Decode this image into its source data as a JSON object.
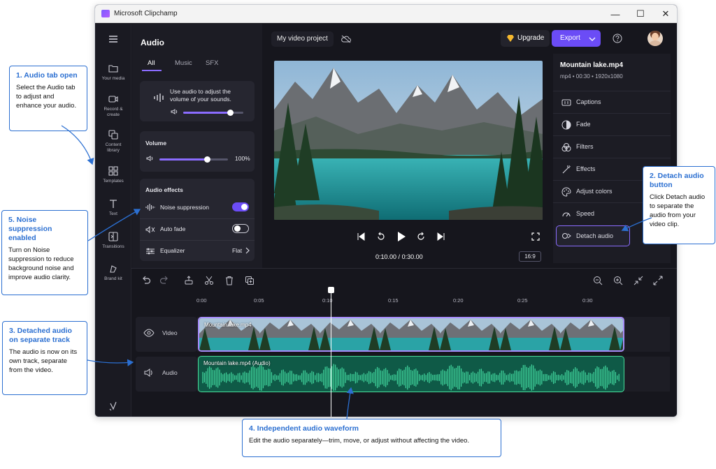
{
  "window": {
    "title": "Microsoft Clipchamp",
    "minimize": "—",
    "maximize": "☐",
    "close": "✕"
  },
  "rail": {
    "items": [
      {
        "label": "Your media",
        "icon": "folder-icon"
      },
      {
        "label": "Record & create",
        "icon": "camera-icon"
      },
      {
        "label": "Content library",
        "icon": "library-icon"
      },
      {
        "label": "Templates",
        "icon": "templates-icon"
      },
      {
        "label": "Text",
        "icon": "text-icon"
      },
      {
        "label": "Transitions",
        "icon": "transitions-icon"
      },
      {
        "label": "Brand kit",
        "icon": "brand-kit-icon"
      }
    ]
  },
  "audio_panel": {
    "title": "Audio",
    "tabs": [
      "All",
      "Music",
      "SFX"
    ],
    "active_tab": "All",
    "info_text": "Use audio to adjust the volume of your sounds.",
    "info_slider_level": 0.78,
    "volume": {
      "label": "Volume",
      "value_text": "100%",
      "level": 0.7
    },
    "effects": {
      "heading": "Audio effects",
      "noise_suppression": {
        "label": "Noise suppression",
        "on": true
      },
      "auto_fade": {
        "label": "Auto fade",
        "on": false
      },
      "equalizer": {
        "label": "Equalizer",
        "value": "Flat"
      }
    }
  },
  "topbar": {
    "project_name": "My video project",
    "upgrade_label": "Upgrade",
    "export_label": "Export"
  },
  "player": {
    "current_time": "0:10.00",
    "separator": "/",
    "total_time": "0:30.00",
    "aspect_ratio": "16:9"
  },
  "properties": {
    "file_name": "Mountain lake.mp4",
    "file_meta": "mp4 • 00:30 • 1920x1080",
    "items": [
      {
        "label": "Captions",
        "icon": "captions-icon"
      },
      {
        "label": "Fade",
        "icon": "fade-icon"
      },
      {
        "label": "Filters",
        "icon": "filters-icon"
      },
      {
        "label": "Effects",
        "icon": "effects-icon"
      },
      {
        "label": "Adjust colors",
        "icon": "adjust-colors-icon"
      },
      {
        "label": "Speed",
        "icon": "speed-icon"
      },
      {
        "label": "Detach audio",
        "icon": "detach-audio-icon"
      }
    ]
  },
  "timeline": {
    "ruler": [
      "0:00",
      "0:05",
      "0:10",
      "0:15",
      "0:20",
      "0:25",
      "0:30"
    ],
    "tracks": {
      "video_label": "Video",
      "audio_label": "Audio"
    },
    "video_clip_name": "Mountain lake.mp4",
    "audio_clip_name": "Mountain lake.mp4 (Audio)"
  },
  "colors": {
    "accent": "#6b4cf6",
    "video_clip_border": "#a78bfa",
    "audio_clip_border": "#4ade9c",
    "callout": "#2b6fd1"
  },
  "callouts": [
    {
      "title": "1. Audio tab open",
      "body": "Select the Audio tab to adjust and enhance your audio."
    },
    {
      "title": "2. Detach audio button",
      "body": "Click Detach audio to separate the audio from your video clip."
    },
    {
      "title": "3. Detached audio on separate track",
      "body": "The audio is now on its own track, separate from the video."
    },
    {
      "title": "4. Independent audio waveform",
      "body": "Edit the audio separately—trim, move, or adjust without affecting the video."
    },
    {
      "title": "5. Noise suppression enabled",
      "body": "Turn on Noise suppression to reduce background noise and improve audio clarity."
    }
  ]
}
